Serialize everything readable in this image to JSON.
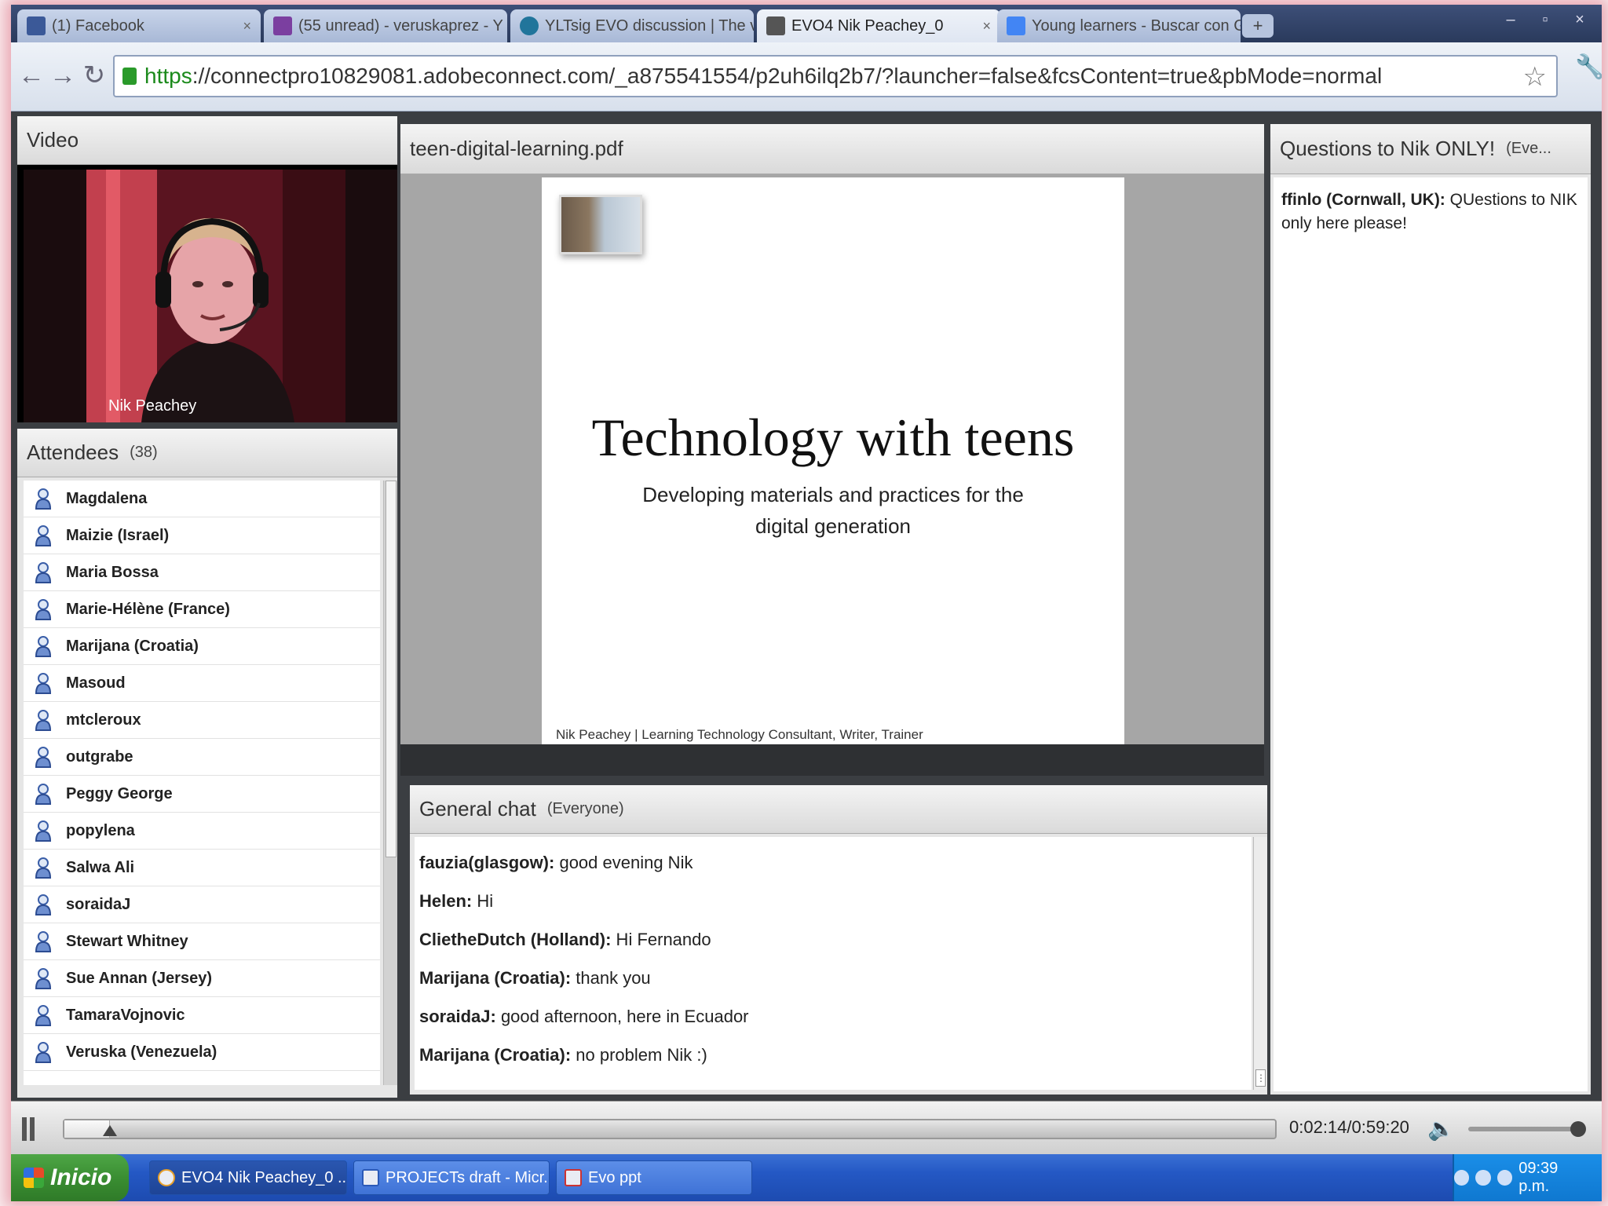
{
  "browser": {
    "tabs": [
      {
        "title": "(1) Facebook",
        "icon_color": "#3b5998"
      },
      {
        "title": "(55 unread) - veruskaprez - Y",
        "icon_color": "#7b3fa0"
      },
      {
        "title": "YLTsig EVO discussion | The v",
        "icon_color": "#21759b"
      },
      {
        "title": "EVO4 Nik Peachey_0",
        "icon_color": "#555555"
      },
      {
        "title": "Young learners - Buscar con G",
        "icon_color": "#4285f4"
      }
    ],
    "new_tab_label": "+",
    "url_scheme": "https",
    "url_rest": "://connectpro10829081.adobeconnect.com/_a875541554/p2uh6ilq2b7/?launcher=false&fcsContent=true&pbMode=normal"
  },
  "video_pod": {
    "title": "Video",
    "presenter_name": "Nik Peachey"
  },
  "attendees_pod": {
    "title": "Attendees",
    "count": "(38)",
    "list": [
      "Magdalena",
      "Maizie (Israel)",
      "Maria Bossa",
      "Marie-Hélène (France)",
      "Marijana (Croatia)",
      "Masoud",
      "mtcleroux",
      "outgrabe",
      "Peggy George",
      "popylena",
      "Salwa Ali",
      "soraidaJ",
      "Stewart Whitney",
      "Sue Annan (Jersey)",
      "TamaraVojnovic",
      "Veruska (Venezuela)"
    ]
  },
  "share_pod": {
    "filename": "teen-digital-learning.pdf",
    "slide_title": "Technology with teens",
    "slide_subtitle": "Developing materials and practices for the digital generation",
    "slide_footer": "Nik Peachey | Learning Technology Consultant, Writer, Trainer"
  },
  "chat_pod": {
    "title": "General chat",
    "scope": "(Everyone)",
    "messages": [
      {
        "author": "fauzia(glasgow):",
        "text": " good evening Nik"
      },
      {
        "author": "Helen:",
        "text": " Hi"
      },
      {
        "author": "ClietheDutch (Holland):",
        "text": " Hi Fernando"
      },
      {
        "author": "Marijana (Croatia):",
        "text": " thank you"
      },
      {
        "author": "soraidaJ:",
        "text": " good afternoon, here in Ecuador"
      },
      {
        "author": "Marijana (Croatia):",
        "text": " no problem Nik :)"
      }
    ]
  },
  "questions_pod": {
    "title": "Questions to Nik ONLY!",
    "scope": "(Eve...",
    "messages": [
      {
        "author": "ffinlo (Cornwall, UK):",
        "text": " QUestions to NIK only here please!"
      }
    ]
  },
  "playback": {
    "time": "0:02:14/0:59:20",
    "progress_fraction": 0.0377,
    "volume_fraction": 1.0
  },
  "taskbar": {
    "start_label": "Inicio",
    "tasks": [
      "EVO4 Nik Peachey_0 ...",
      "PROJECTs draft - Micr...",
      "Evo ppt"
    ],
    "clock": "09:39 p.m."
  }
}
